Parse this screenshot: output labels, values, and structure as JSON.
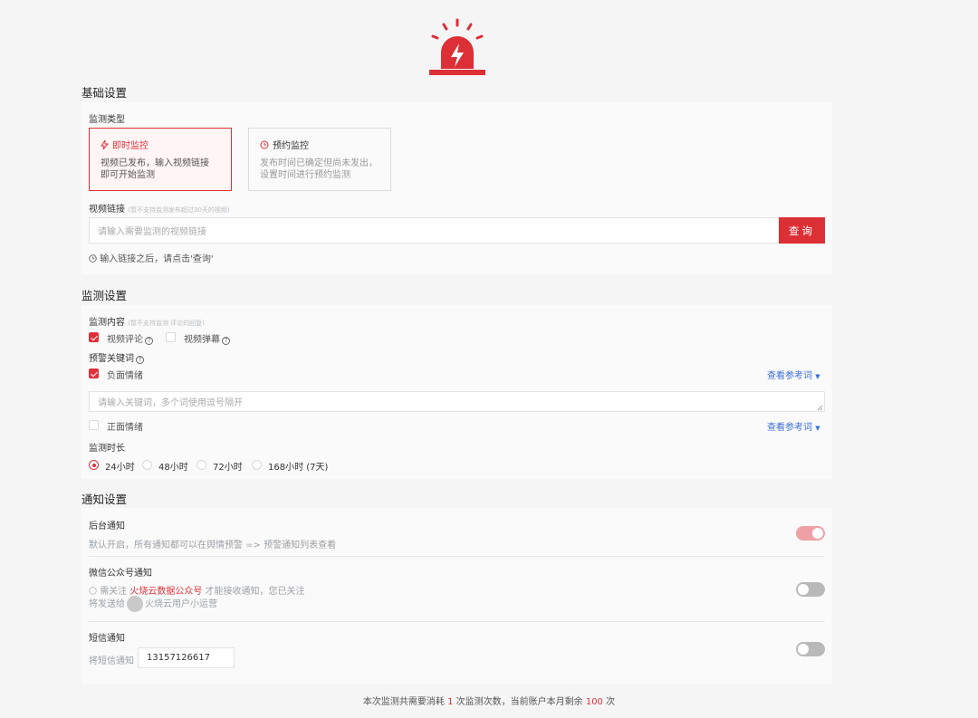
{
  "colors": {
    "accent": "#dc2f36",
    "link": "#3b6fd8",
    "toggle_on": "#f0a1a5",
    "toggle_off": "#b9b9b9"
  },
  "basic": {
    "title": "基础设置",
    "type_label": "监测类型",
    "card_instant": {
      "icon": "lightning-icon",
      "title": "即时监控",
      "desc1": "视频已发布，输入视频链接",
      "desc2": "即可开始监测"
    },
    "card_scheduled": {
      "icon": "clock-icon",
      "title": "预约监控",
      "desc1": "发布时间已确定但尚未发出，",
      "desc2": "设置时间进行预约监测"
    },
    "link_label": "视频链接",
    "link_hint": "(暂不支持监测发布超过30天的视频)",
    "link_placeholder": "请输入需要监测的视频链接",
    "query_button": "查询",
    "tip": "输入链接之后，请点击'查询'"
  },
  "monitor": {
    "title": "监测设置",
    "content_label": "监测内容",
    "content_hint": "(暂不支持监测 评论的回复)",
    "opt_comment": "视频评论",
    "opt_danmu": "视频弹幕",
    "keyword_label": "预警关键词",
    "negative": "负面情绪",
    "view_ref": "查看参考词",
    "keyword_placeholder": "请输入关键词，多个词使用逗号隔开",
    "positive": "正面情绪",
    "duration_label": "监测时长",
    "durations": [
      "24小时",
      "48小时",
      "72小时",
      "168小时 (7天)"
    ],
    "selected_duration": "24小时",
    "states": {
      "comment": true,
      "danmu": false,
      "negative": true,
      "positive": false
    }
  },
  "notify": {
    "title": "通知设置",
    "backend_title": "后台通知",
    "backend_desc": "默认开启，所有通知都可以在舆情预警 => 预警通知列表查看",
    "backend_on": true,
    "wechat_title": "微信公众号通知",
    "wechat_pre": "需关注",
    "wechat_account": "火烧云数据公众号",
    "wechat_post": "才能接收通知，您已关注",
    "wechat_send": "将发送给",
    "wechat_user": "火烧云用户小运营",
    "wechat_on": false,
    "sms_title": "短信通知",
    "sms_label": "将短信通知",
    "sms_phone": "13157126617",
    "sms_on": false
  },
  "footer": {
    "pre": "本次监测共需要消耗",
    "count": "1",
    "mid": "次监测次数，当前账户本月剩余",
    "remain": "100",
    "post": "次"
  }
}
